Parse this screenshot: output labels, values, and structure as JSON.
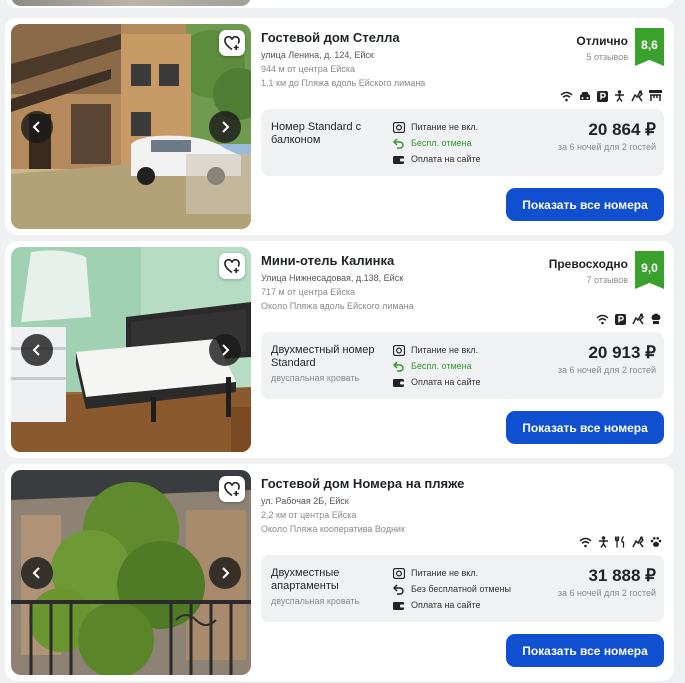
{
  "colors": {
    "accent": "#0f4fd0",
    "rating_badge": "#3aa12c",
    "free_cancel": "#2f9a2a",
    "card_bg": "#ffffff",
    "page_bg": "#eef0f2"
  },
  "cards": [
    {
      "title": "Гостевой дом Стелла",
      "address": "улица Ленина, д. 124, Ейск",
      "distance_center": "944 м от центра Ейска",
      "distance_beach": "1,1 км до Пляжа вдоль Ейского лимана",
      "rating_word": "Отлично",
      "reviews": "5 отзывов",
      "score": "8,6",
      "amenities": [
        "wifi-icon",
        "car-icon",
        "parking-icon",
        "kids-icon",
        "pets-icon",
        "bbq-grill-icon"
      ],
      "room": {
        "name": "Номер Standard с балконом",
        "bed": "",
        "meals": "Питание не вкл.",
        "cancel": "Беспл. отмена",
        "cancel_free": true,
        "payment": "Оплата на сайте",
        "price": "20 864 ₽",
        "price_note": "за 6 ночей для 2 гостей"
      },
      "cta": "Показать все номера"
    },
    {
      "title": "Мини-отель Калинка",
      "address": "Улица Нижнесадовая, д.138, Ейск",
      "distance_center": "717 м от центра Ейска",
      "distance_beach": "Около Пляжа вдоль Ейского лимана",
      "rating_word": "Превосходно",
      "reviews": "7 отзывов",
      "score": "9,0",
      "amenities": [
        "wifi-icon",
        "parking-icon",
        "pets-icon",
        "chef-hat-icon"
      ],
      "room": {
        "name": "Двухместный номер Standard",
        "bed": "двуспальная кровать",
        "meals": "Питание не вкл.",
        "cancel": "Беспл. отмена",
        "cancel_free": true,
        "payment": "Оплата на сайте",
        "price": "20 913 ₽",
        "price_note": "за 6 ночей для 2 гостей"
      },
      "cta": "Показать все номера"
    },
    {
      "title": "Гостевой дом Номера на пляже",
      "address": "ул. Рабочая 2Б, Ейск",
      "distance_center": "2,2 км от центра Ейска",
      "distance_beach": "Около Пляжа кооператива Водник",
      "rating_word": "",
      "reviews": "",
      "score": "",
      "amenities": [
        "wifi-icon",
        "kids-icon",
        "restaurant-icon",
        "pets-icon",
        "paw-icon"
      ],
      "room": {
        "name": "Двухместные апартаменты",
        "bed": "двуспальная кровать",
        "meals": "Питание не вкл.",
        "cancel": "Без бесплатной отмены",
        "cancel_free": false,
        "payment": "Оплата на сайте",
        "price": "31 888 ₽",
        "price_note": "за 6 ночей для 2 гостей"
      },
      "cta": "Показать все номера"
    }
  ]
}
